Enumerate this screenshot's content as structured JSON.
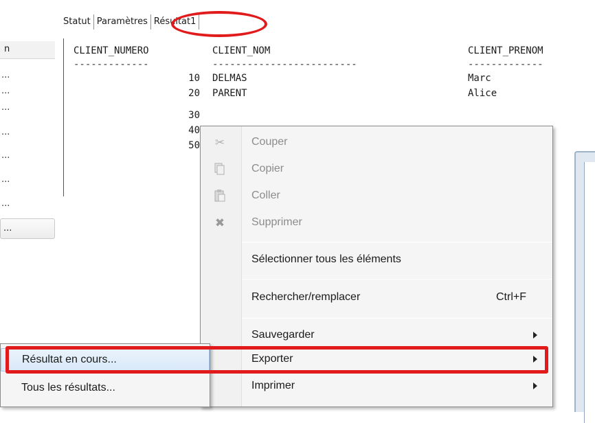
{
  "tabs": [
    {
      "label": "Statut"
    },
    {
      "label": "Paramètres"
    },
    {
      "label": "Résultat1"
    }
  ],
  "left_panel": {
    "header": "n",
    "rows": [
      "...",
      "...",
      "...",
      "...",
      "...",
      "...",
      "..."
    ],
    "button_label": "..."
  },
  "results": {
    "columns": [
      "CLIENT_NUMERO",
      "CLIENT_NOM",
      "CLIENT_PRENOM"
    ],
    "separators": [
      "-------------",
      "-------------------------",
      "-------------"
    ],
    "rows": [
      {
        "num": "10",
        "nom": "DELMAS",
        "prenom": "Marc"
      },
      {
        "num": "20",
        "nom": "PARENT",
        "prenom": "Alice"
      },
      {
        "num": "30",
        "nom": "",
        "prenom": ""
      },
      {
        "num": "40",
        "nom": "",
        "prenom": ""
      },
      {
        "num": "50",
        "nom": "",
        "prenom": ""
      }
    ]
  },
  "context_menu": {
    "items": [
      {
        "label": "Couper",
        "icon": "scissors-icon",
        "disabled": true
      },
      {
        "label": "Copier",
        "icon": "copy-icon",
        "disabled": true
      },
      {
        "label": "Coller",
        "icon": "paste-icon",
        "disabled": true
      },
      {
        "label": "Supprimer",
        "icon": "delete-icon",
        "disabled": true
      },
      {
        "label": "Sélectionner tous les éléments"
      },
      {
        "label": "Rechercher/remplacer",
        "shortcut": "Ctrl+F"
      },
      {
        "label": "Sauvegarder",
        "submenu": true
      },
      {
        "label": "Exporter",
        "submenu": true
      },
      {
        "label": "Imprimer",
        "submenu": true
      }
    ]
  },
  "export_submenu": {
    "items": [
      {
        "label": "Résultat en cours..."
      },
      {
        "label": "Tous les résultats..."
      }
    ]
  },
  "colors": {
    "highlight": "#e11b1b",
    "menu_bg": "#f5f5f5",
    "hover_bg": "#d9e9f8"
  }
}
